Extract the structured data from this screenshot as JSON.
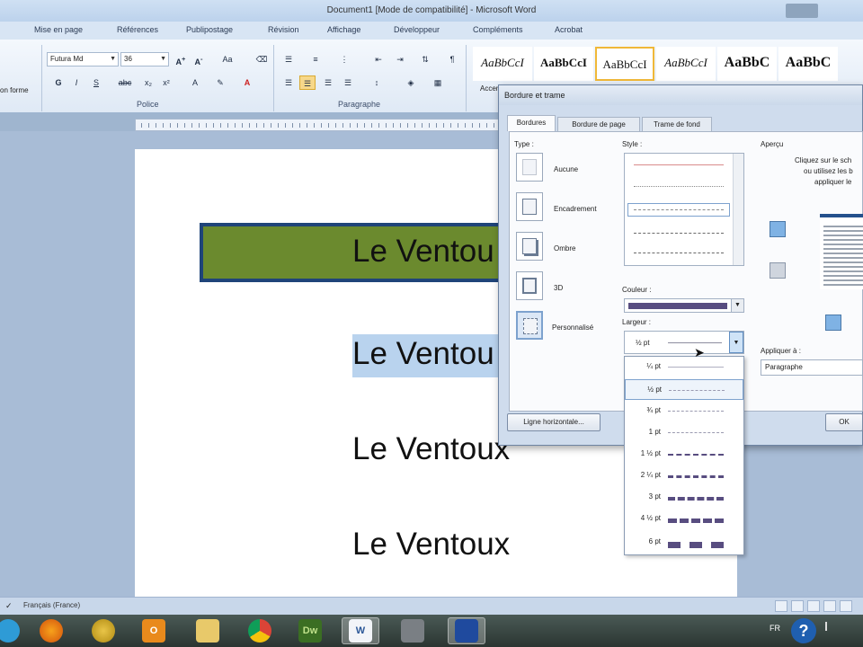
{
  "window": {
    "title": "Document1 [Mode de compatibilité] - Microsoft Word"
  },
  "ribbon": {
    "tabs": [
      "Mise en page",
      "Références",
      "Publipostage",
      "Révision",
      "Affichage",
      "Développeur",
      "Compléments",
      "Acrobat"
    ],
    "left_fragment": "on forme",
    "font_name": "Futura Md",
    "font_size": "36",
    "group_police": "Police",
    "group_paragraphe": "Paragraphe",
    "styles": [
      "AaBbCcI",
      "AaBbCcI",
      "AaBbCcI",
      "AaBbCcI",
      "AaBbC",
      "AaBbC"
    ],
    "style_caption": "Accent"
  },
  "document": {
    "lines": [
      "Le Ventou",
      "Le Ventou",
      "Le Ventoux",
      "Le Ventoux"
    ],
    "box_fill": "#6b8a2e",
    "box_border": "#1f4479",
    "highlight": "#b9d3ee"
  },
  "dialog": {
    "title": "Bordure et trame",
    "tabs": [
      "Bordures",
      "Bordure de page",
      "Trame de fond"
    ],
    "type_label": "Type :",
    "types": [
      "Aucune",
      "Encadrement",
      "Ombre",
      "3D",
      "Personnalisé"
    ],
    "style_label": "Style :",
    "color_label": "Couleur :",
    "color_value": "#584d80",
    "width_label": "Largeur :",
    "width_value": "½ pt",
    "preview_label": "Aperçu",
    "preview_text": [
      "Cliquez sur le sch",
      "ou utilisez les b",
      "appliquer le"
    ],
    "apply_label": "Appliquer à :",
    "apply_value": "Paragraphe",
    "horizontal_button": "Ligne horizontale...",
    "ok_button": "OK",
    "width_options": [
      "¼ pt",
      "½ pt",
      "¾ pt",
      "1 pt",
      "1 ½ pt",
      "2 ¼ pt",
      "3 pt",
      "4 ½ pt",
      "6 pt"
    ],
    "width_selected": "½ pt"
  },
  "statusbar": {
    "language": "Français (France)"
  },
  "taskbar": {
    "apps": [
      "firefox-icon",
      "flash-icon",
      "outlook-icon",
      "explorer-icon",
      "chrome-icon",
      "dreamweaver-icon",
      "word-icon",
      "paint-icon",
      "capture-icon"
    ],
    "dw_label": "Dw",
    "word_label": "W",
    "lang": "FR"
  }
}
